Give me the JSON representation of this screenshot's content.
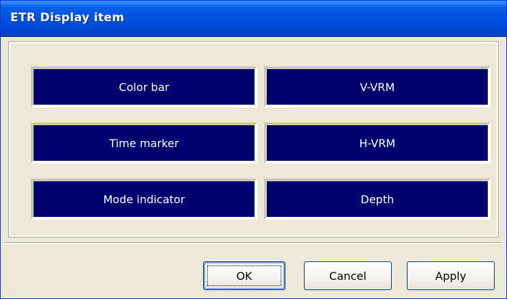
{
  "window": {
    "title": "ETR Display item"
  },
  "items": [
    {
      "label": "Color bar"
    },
    {
      "label": "V-VRM"
    },
    {
      "label": "Time marker"
    },
    {
      "label": "H-VRM"
    },
    {
      "label": "Mode indicator"
    },
    {
      "label": "Depth"
    }
  ],
  "buttons": {
    "ok": "OK",
    "cancel": "Cancel",
    "apply": "Apply"
  },
  "colors": {
    "title_bar": "#0052e0",
    "item_background": "#00006e",
    "item_text": "#ffffff",
    "dialog_face": "#ece9d8"
  }
}
